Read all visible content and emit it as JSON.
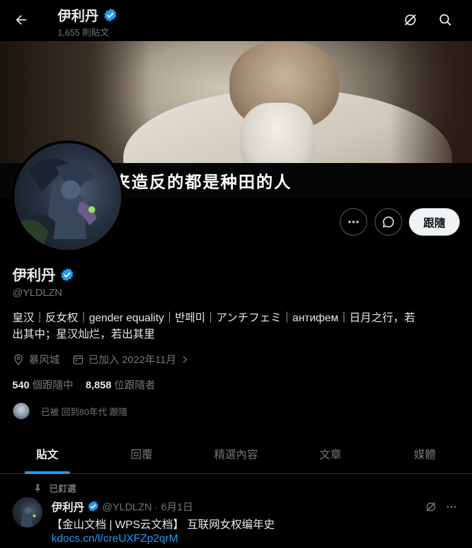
{
  "topbar": {
    "name": "伊利丹",
    "post_count": "1,655 則貼文"
  },
  "banner": {
    "subtitle": "而来造反的都是种田的人"
  },
  "actions": {
    "follow_label": "跟隨"
  },
  "profile": {
    "name": "伊利丹",
    "handle": "@YLDLZN",
    "bio_line1": "皇汉｜反女权｜gender equality｜반페미｜アンチフェミ｜антифем｜日月之行，若",
    "bio_line2": "出其中；星汉灿烂，若出其里",
    "location": "暴风城",
    "joined": "已加入 2022年11月",
    "following_count": "540",
    "following_label": "個跟隨中",
    "followers_count": "8,858",
    "followers_label": "位跟隨者",
    "followed_by": "已被 回到80年代 跟隨"
  },
  "tabs": [
    {
      "label": "貼文"
    },
    {
      "label": "回覆"
    },
    {
      "label": "精選內容"
    },
    {
      "label": "文章"
    },
    {
      "label": "媒體"
    }
  ],
  "tweet": {
    "pinned_label": "已釘選",
    "name": "伊利丹",
    "handle_date": "@YLDLZN · 6月1日",
    "text": "【金山文档 | WPS云文档】 互联网女权编年史",
    "link": "kdocs.cn/l/creUXFZp2qrM"
  },
  "colors": {
    "accent": "#1d9bf0",
    "muted": "#71767b",
    "text": "#e7e9ea",
    "follow_button_bg": "#eff3f4"
  },
  "icons": {
    "back": "arrow-left-icon",
    "grok": "grok-icon",
    "search": "search-icon",
    "verified": "verified-badge-icon",
    "more": "more-icon",
    "message": "message-icon",
    "location": "location-icon",
    "calendar": "calendar-icon",
    "chevron": "chevron-right-icon",
    "pin": "pin-icon"
  }
}
